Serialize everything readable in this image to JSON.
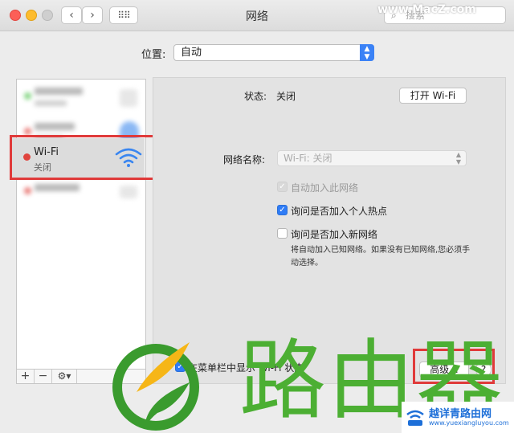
{
  "window": {
    "title": "网络",
    "search_placeholder": "搜索",
    "watermark": "www.MacZ.com"
  },
  "location": {
    "label": "位置:",
    "value": "自动"
  },
  "sidebar": {
    "services": [
      {
        "name": "Wi-Fi",
        "status": "关闭",
        "status_color": "#e0443e",
        "icon": "wifi-icon"
      }
    ],
    "add_label": "+",
    "remove_label": "−",
    "action_label": "⚙▾"
  },
  "detail": {
    "status_label": "状态:",
    "status_value": "关闭",
    "toggle_button": "打开 Wi-Fi",
    "network_name_label": "网络名称:",
    "network_name_value": "Wi-Fi: 关闭",
    "checkboxes": [
      {
        "label": "自动加入此网络",
        "state": "disabled-checked"
      },
      {
        "label": "询问是否加入个人热点",
        "state": "checked"
      },
      {
        "label": "询问是否加入新网络",
        "state": "unchecked"
      }
    ],
    "note": "将自动加入已知网络。如果没有已知网络,您必须手动选择。",
    "show_in_menubar": "在菜单栏中显示 Wi-Fi 状态",
    "advanced_button": "高级...",
    "help_button": "?"
  },
  "overlay": {
    "big_text": "路由器",
    "brand_text": "越详青路由网",
    "brand_url": "www.yuexiangluyou.com"
  },
  "colors": {
    "accent": "#2f7cf6",
    "highlight": "#e03a3a",
    "overlay_green": "#4caf33"
  }
}
